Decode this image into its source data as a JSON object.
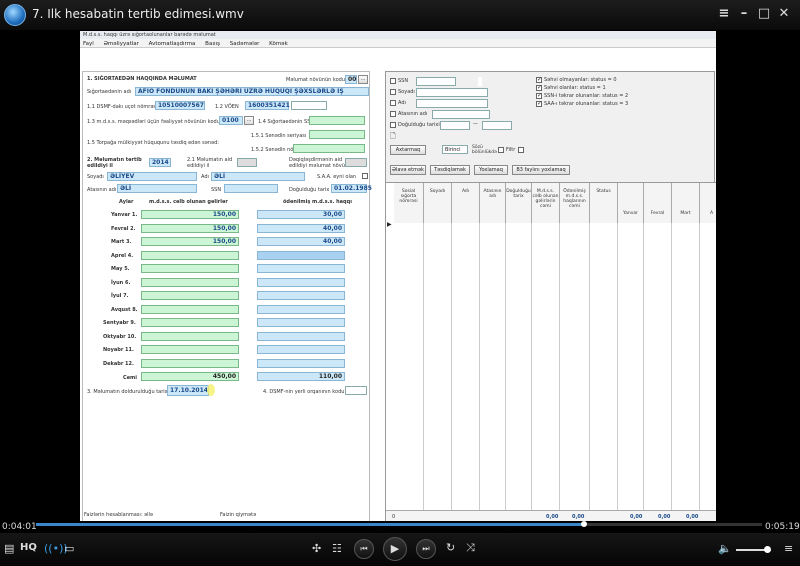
{
  "window": {
    "title": "7. Ilk hesabatin tertib edimesi.wmv"
  },
  "app": {
    "title": "M.d.s.s. haqqı üzrə sığortaolunanlar barədə məlumat",
    "menu": [
      "Fayl",
      "Əməliyyatlar",
      "Avtomatlaşdırma",
      "Baxış",
      "Sadəmələr",
      "Kömək"
    ]
  },
  "form": {
    "section1": "1. SIĞORTAEDƏN HAQQINDA MƏLUMAT",
    "doc_type_label": "Məlumat növünün kodu",
    "doc_type_value": "00",
    "insurer_label": "Sığortaedənin adı",
    "insurer_value": "AFİO FONDUNUN BAKI ŞƏHƏRİ ÜZRƏ HÜQUQİ ŞƏXSLƏRLƏ İŞ DEPARTAMENTİ",
    "dsmf_label": "1.1 DSMF-dakı uçot nömrəsi",
    "dsmf_value": "10510007567",
    "voen_label": "1.2 VÖEN",
    "voen_value": "1600351421",
    "mdss_label": "1.3 m.d.s.s. məqsədləri üçün fəaliyyət növünün kodu",
    "mdss_value": "0100",
    "ssn_label": "1.4 Sığortaedənin SSN-i",
    "s1_label": "1.5.1 Sənədin seriyası",
    "land_label": "1.5 Torpağa mülkiyyət hüququnu təsdiq edən sənəd:",
    "s2_label": "1.5.2 Sənədin nömrəsi",
    "section2": "2. Məlumatın tərtib edildiyi il",
    "year_value": "2014",
    "accounting_label": "2.1 Məlumatın aid edildiyi il",
    "clarify_label": "Dəqiqləşdirmənin aid edildiyi məlumat növü",
    "surname_label": "Soyadı",
    "surname_value": "ƏLİYEV",
    "name_label": "Adı",
    "name_value": "ƏLİ",
    "saa_label": "S.A.A. eyni olan",
    "father_label": "Atasının adı",
    "father_value": "ƏLİ",
    "ssn2_label": "SSN",
    "birth_label": "Doğulduğu tarix",
    "birth_value": "01.02.1985",
    "col_months": "Aylar",
    "col_income": "m.d.s.s. cəlb olunan gəlirlər",
    "col_paid": "ödənilmiş m.d.s.s. haqqı",
    "months": [
      {
        "name": "Yanvar 1.",
        "income": "150,00",
        "paid": "30,00"
      },
      {
        "name": "Fevral 2.",
        "income": "150,00",
        "paid": "40,00"
      },
      {
        "name": "Mart 3.",
        "income": "150,00",
        "paid": "40,00"
      },
      {
        "name": "Aprel 4.",
        "income": "",
        "paid": ""
      },
      {
        "name": "May 5.",
        "income": "",
        "paid": ""
      },
      {
        "name": "İyun 6.",
        "income": "",
        "paid": ""
      },
      {
        "name": "İyul 7.",
        "income": "",
        "paid": ""
      },
      {
        "name": "Avqust 8.",
        "income": "",
        "paid": ""
      },
      {
        "name": "Sentyabr 9.",
        "income": "",
        "paid": ""
      },
      {
        "name": "Oktyabr 10.",
        "income": "",
        "paid": ""
      },
      {
        "name": "Noyabr 11.",
        "income": "",
        "paid": ""
      },
      {
        "name": "Dekabr 12.",
        "income": "",
        "paid": ""
      }
    ],
    "total_label": "Cəmi",
    "total_income": "450,00",
    "total_paid": "110,00",
    "date_label": "3. Məlumatın doldurulduğu tarix",
    "date_value": "17.10.2014",
    "dsmf_code_label": "4. DSMF-nin yerli orqanının kodu"
  },
  "right": {
    "filter_labels": [
      "SSN",
      "Soyadı",
      "Adı",
      "Atasının adı",
      "Doğulduğu tarixi"
    ],
    "status_labels": [
      "Səhvi olmayanlar: status = 0",
      "Səhvi olanlar: status = 1",
      "SSN-i təkrar olunanlar: status = 2",
      "SAA-ı təkrar olunanlar: status = 3"
    ],
    "search_btn": "Axtarmaq",
    "first_label": "Birinci",
    "sort_label": "Sözü bölünlükdə",
    "filter_label": "Filtr",
    "tab_add": "Əlavə etmək",
    "tab_edit": "Təsdiqləmək",
    "tab_check": "Yoxlamaq",
    "tab_b3": "B3 faylını yoxlamaq",
    "columns": [
      "Sosial sığorta nömrəsi",
      "Soyadı",
      "Adı",
      "Atasının adı",
      "Doğulduğu tarix",
      "M.d.s.s. cəlb olunan gəlirlərin cəmi",
      "Ödənilmiş m.d.s.s. haqlarının cəmi",
      "Status",
      "Yanvar",
      "Fevral",
      "Mart",
      "A"
    ],
    "foot_count": "0",
    "foot_vals": [
      "0,00",
      "0,00",
      "0,00",
      "0,00",
      "0,00"
    ]
  },
  "player": {
    "time_current": "0:04:01",
    "time_total": "0:05:19",
    "progress": 0.755,
    "hq": "HQ",
    "status_left": "Faizlərin hesablanması: əllə",
    "status_right": "Faizin qiymətə"
  }
}
